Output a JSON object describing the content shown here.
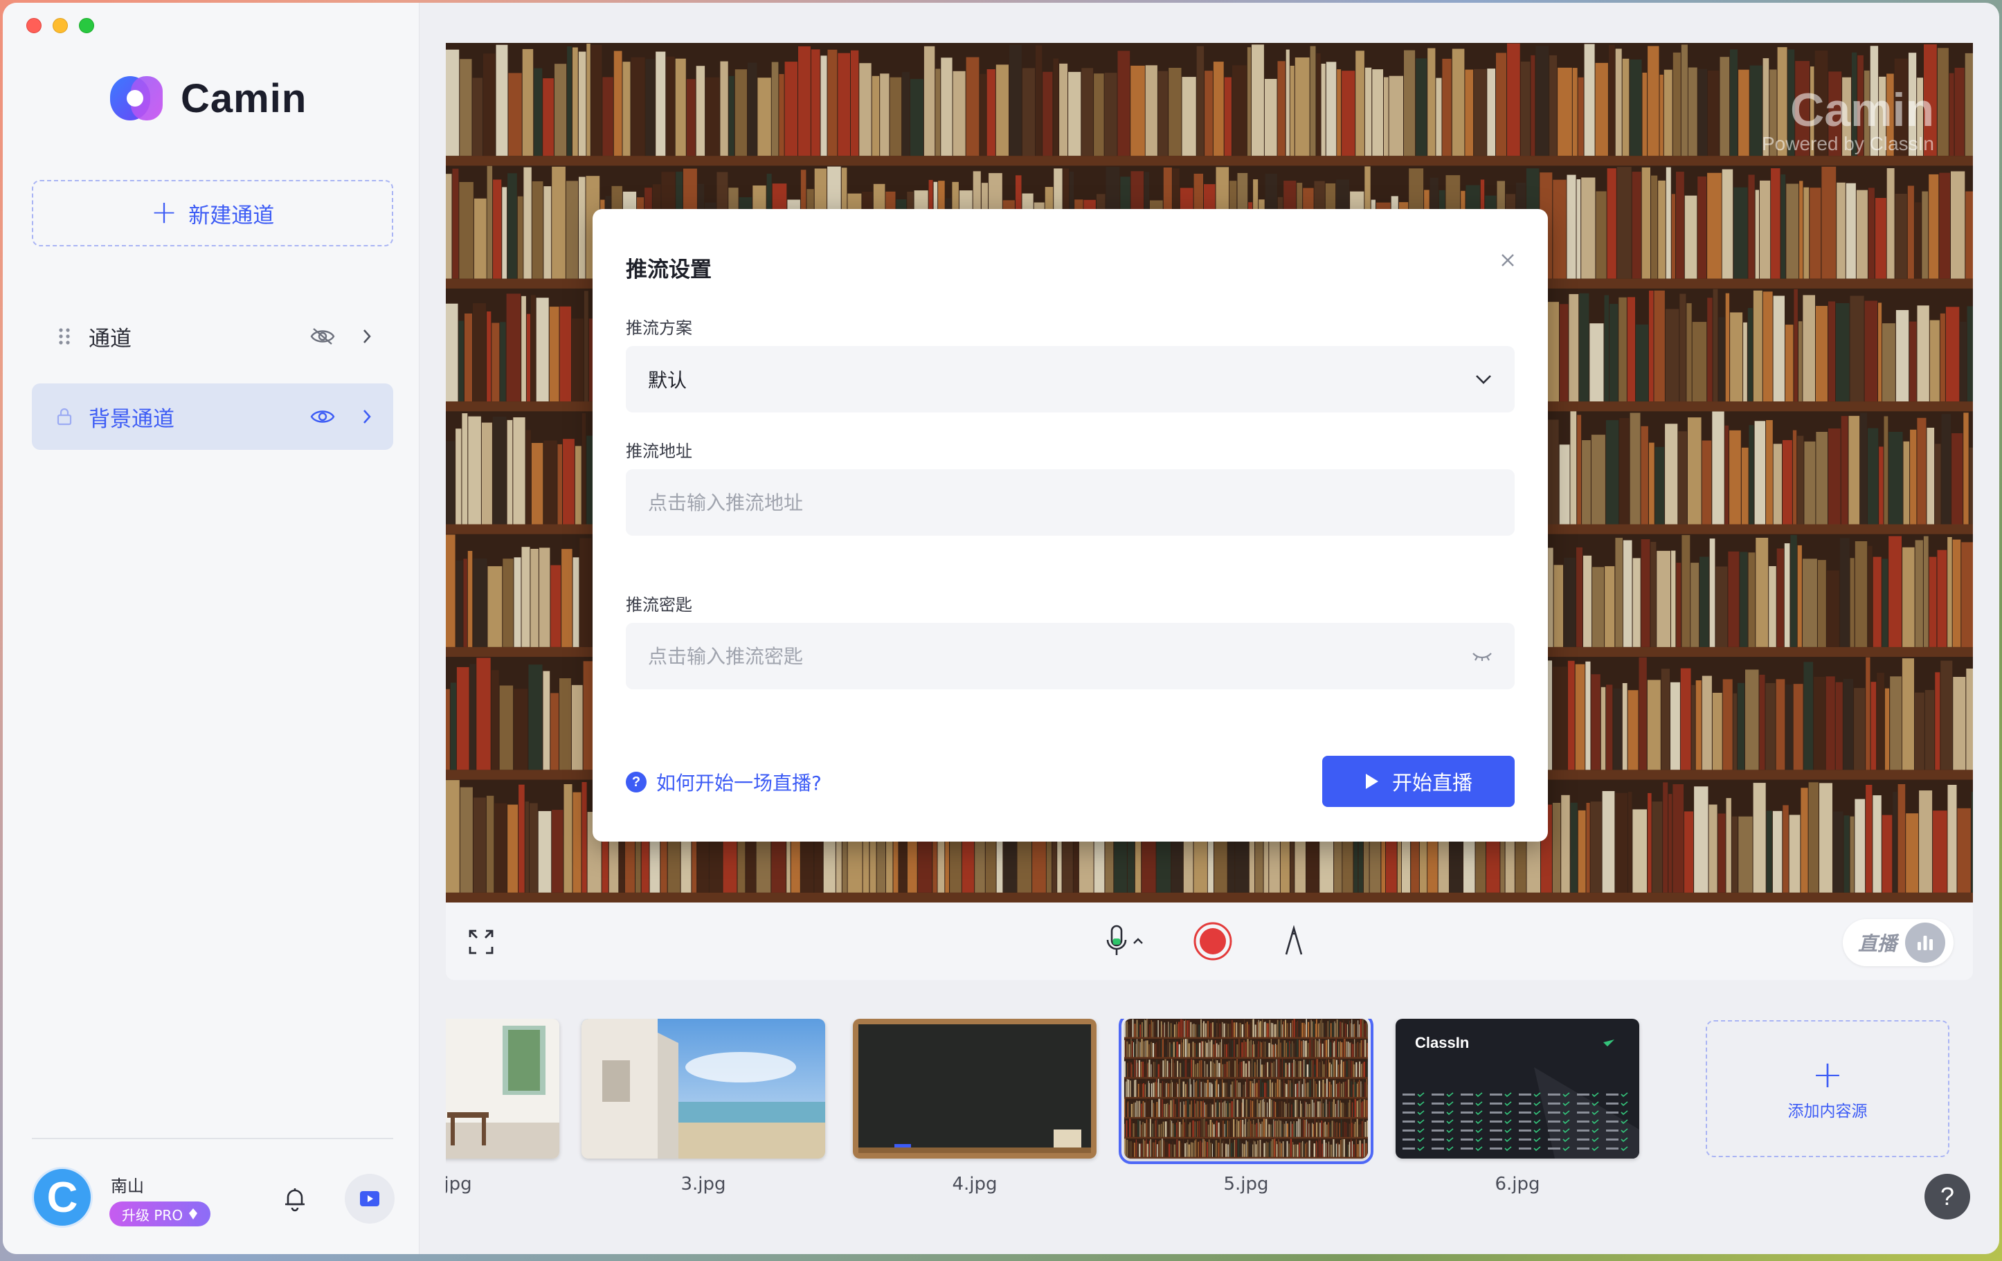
{
  "app": {
    "name": "Camin",
    "colors": {
      "accent": "#3d5cf5",
      "record": "#e33b3b"
    }
  },
  "sidebar": {
    "new_channel_label": "新建通道",
    "items": [
      {
        "label": "通道",
        "lead_icon": "drag-handle-icon",
        "visibility_icon": "eye-off-icon",
        "active": false
      },
      {
        "label": "背景通道",
        "lead_icon": "lock-icon",
        "visibility_icon": "eye-icon",
        "active": true
      }
    ],
    "user": {
      "avatar_letter": "C",
      "name": "南山",
      "upgrade_label": "升级 PRO"
    }
  },
  "preview": {
    "watermark_title": "Camin",
    "watermark_sub": "Powered by ClassIn"
  },
  "dialog": {
    "title": "推流设置",
    "scheme_label": "推流方案",
    "scheme_value": "默认",
    "url_label": "推流地址",
    "url_placeholder": "点击输入推流地址",
    "key_label": "推流密匙",
    "key_placeholder": "点击输入推流密匙",
    "help_text": "如何开始一场直播?",
    "start_label": "开始直播"
  },
  "toolbar": {
    "live_label": "直播"
  },
  "thumbnails": [
    {
      "caption": "'.jpg",
      "kind": "room"
    },
    {
      "caption": "3.jpg",
      "kind": "seaside"
    },
    {
      "caption": "4.jpg",
      "kind": "chalkboard"
    },
    {
      "caption": "5.jpg",
      "kind": "bookshelf",
      "selected": true
    },
    {
      "caption": "6.jpg",
      "kind": "classin"
    }
  ],
  "thumb6_text": "ClassIn",
  "add_source_label": "添加内容源",
  "help_fab": "?"
}
